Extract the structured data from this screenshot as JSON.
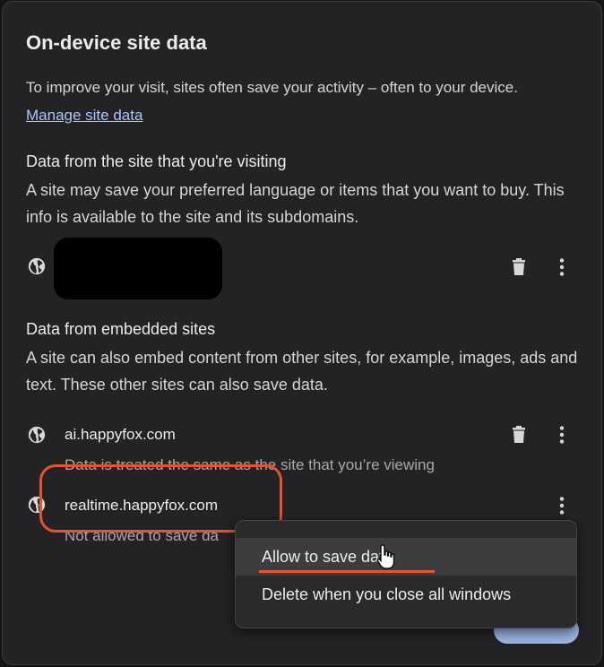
{
  "dialog": {
    "title": "On-device site data",
    "intro_text": "To improve your visit, sites often save your activity – often to your device.",
    "manage_link": "Manage site data"
  },
  "visiting_section": {
    "heading": "Data from the site that you're visiting",
    "description": "A site may save your preferred language or items that you want to buy. This info is available to the site and its subdomains."
  },
  "embedded_section": {
    "heading": "Data from embedded sites",
    "description": "A site can also embed content from other sites, for example, images, ads and text. These other sites can also save data.",
    "sites": [
      {
        "name": "ai.happyfox.com",
        "subtitle": "Data is treated the same as the site that you’re viewing"
      },
      {
        "name": "realtime.happyfox.com",
        "subtitle": "Not allowed to save da"
      }
    ]
  },
  "context_menu": {
    "items": [
      {
        "label": "Allow to save data"
      },
      {
        "label": "Delete when you close all windows"
      }
    ]
  },
  "colors": {
    "accent": "#a8c7fa",
    "annotation": "#e8532a",
    "background": "#232325"
  },
  "icons": {
    "site": "globe-icon",
    "delete": "trash-icon",
    "more": "more-vert-icon"
  }
}
